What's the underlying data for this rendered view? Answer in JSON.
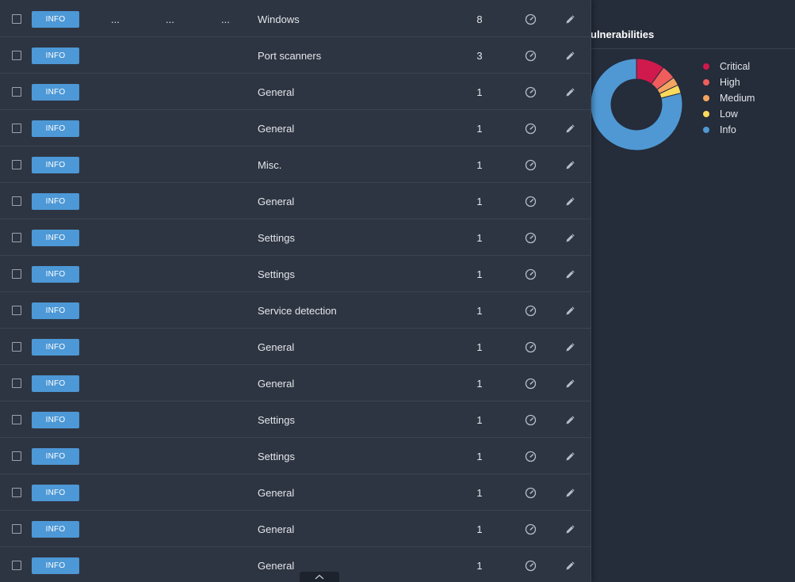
{
  "side_panel": {
    "title": "ulnerabilities",
    "legend": [
      {
        "label": "Critical",
        "color": "#d0194c"
      },
      {
        "label": "High",
        "color": "#ef5d5d"
      },
      {
        "label": "Medium",
        "color": "#f5a561"
      },
      {
        "label": "Low",
        "color": "#fbd95b"
      },
      {
        "label": "Info",
        "color": "#4f98d3"
      }
    ]
  },
  "chart_data": {
    "type": "pie",
    "style": "donut",
    "categories": [
      "Critical",
      "High",
      "Medium",
      "Low",
      "Info"
    ],
    "values": [
      10,
      5,
      3,
      3,
      79
    ],
    "colors": [
      "#d0194c",
      "#ef5d5d",
      "#f5a561",
      "#fbd95b",
      "#4f98d3"
    ],
    "legend_position": "right"
  },
  "table": {
    "rows": [
      {
        "severity": "INFO",
        "col_a": "...",
        "col_b": "...",
        "col_c": "...",
        "family": "Windows",
        "count": "8"
      },
      {
        "severity": "INFO",
        "col_a": "",
        "col_b": "",
        "col_c": "",
        "family": "Port scanners",
        "count": "3"
      },
      {
        "severity": "INFO",
        "col_a": "",
        "col_b": "",
        "col_c": "",
        "family": "General",
        "count": "1"
      },
      {
        "severity": "INFO",
        "col_a": "",
        "col_b": "",
        "col_c": "",
        "family": "General",
        "count": "1"
      },
      {
        "severity": "INFO",
        "col_a": "",
        "col_b": "",
        "col_c": "",
        "family": "Misc.",
        "count": "1"
      },
      {
        "severity": "INFO",
        "col_a": "",
        "col_b": "",
        "col_c": "",
        "family": "General",
        "count": "1"
      },
      {
        "severity": "INFO",
        "col_a": "",
        "col_b": "",
        "col_c": "",
        "family": "Settings",
        "count": "1"
      },
      {
        "severity": "INFO",
        "col_a": "",
        "col_b": "",
        "col_c": "",
        "family": "Settings",
        "count": "1"
      },
      {
        "severity": "INFO",
        "col_a": "",
        "col_b": "",
        "col_c": "",
        "family": "Service detection",
        "count": "1"
      },
      {
        "severity": "INFO",
        "col_a": "",
        "col_b": "",
        "col_c": "",
        "family": "General",
        "count": "1"
      },
      {
        "severity": "INFO",
        "col_a": "",
        "col_b": "",
        "col_c": "",
        "family": "General",
        "count": "1"
      },
      {
        "severity": "INFO",
        "col_a": "",
        "col_b": "",
        "col_c": "",
        "family": "Settings",
        "count": "1"
      },
      {
        "severity": "INFO",
        "col_a": "",
        "col_b": "",
        "col_c": "",
        "family": "Settings",
        "count": "1"
      },
      {
        "severity": "INFO",
        "col_a": "",
        "col_b": "",
        "col_c": "",
        "family": "General",
        "count": "1"
      },
      {
        "severity": "INFO",
        "col_a": "",
        "col_b": "",
        "col_c": "",
        "family": "General",
        "count": "1"
      },
      {
        "severity": "INFO",
        "col_a": "",
        "col_b": "",
        "col_c": "",
        "family": "General",
        "count": "1"
      }
    ],
    "row_icons": {
      "status": "gauge-icon",
      "action": "pencil-icon"
    },
    "severity_color": "#4d98d6"
  },
  "collapse_icon": "chevron-up-icon"
}
